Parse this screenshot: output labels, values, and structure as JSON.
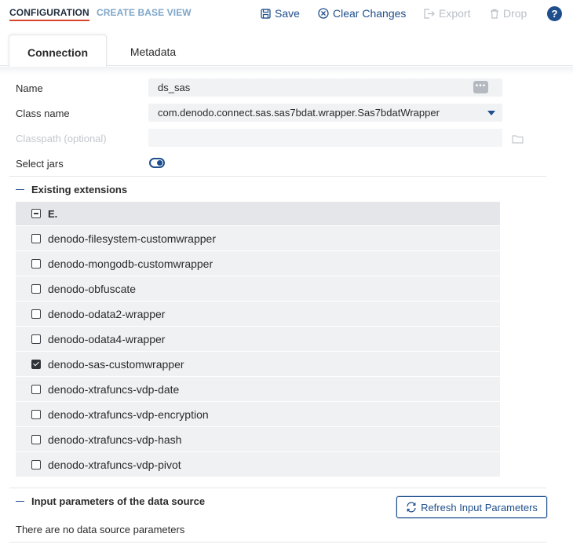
{
  "header": {
    "tabs": [
      {
        "label": "CONFIGURATION",
        "active": true
      },
      {
        "label": "CREATE BASE VIEW",
        "active": false
      }
    ],
    "actions": [
      {
        "label": "Save",
        "icon": "save-icon",
        "enabled": true
      },
      {
        "label": "Clear Changes",
        "icon": "clear-icon",
        "enabled": true
      },
      {
        "label": "Export",
        "icon": "export-icon",
        "enabled": false
      },
      {
        "label": "Drop",
        "icon": "trash-icon",
        "enabled": false
      }
    ],
    "help_label": "?"
  },
  "subtabs": [
    {
      "label": "Connection",
      "active": true
    },
    {
      "label": "Metadata",
      "active": false
    }
  ],
  "form": {
    "name_label": "Name",
    "name_value": "ds_sas",
    "name_more": "•••",
    "class_label": "Class name",
    "class_value": "com.denodo.connect.sas.sas7bdat.wrapper.Sas7bdatWrapper",
    "classpath_label": "Classpath (optional)",
    "classpath_value": "",
    "select_jars_label": "Select jars",
    "select_jars_on": true
  },
  "extensions": {
    "title": "Existing extensions",
    "group_label": "E.",
    "items": [
      {
        "label": "denodo-filesystem-customwrapper",
        "checked": false
      },
      {
        "label": "denodo-mongodb-customwrapper",
        "checked": false
      },
      {
        "label": "denodo-obfuscate",
        "checked": false
      },
      {
        "label": "denodo-odata2-wrapper",
        "checked": false
      },
      {
        "label": "denodo-odata4-wrapper",
        "checked": false
      },
      {
        "label": "denodo-sas-customwrapper",
        "checked": true
      },
      {
        "label": "denodo-xtrafuncs-vdp-date",
        "checked": false
      },
      {
        "label": "denodo-xtrafuncs-vdp-encryption",
        "checked": false
      },
      {
        "label": "denodo-xtrafuncs-vdp-hash",
        "checked": false
      },
      {
        "label": "denodo-xtrafuncs-vdp-pivot",
        "checked": false
      }
    ]
  },
  "input_params": {
    "title": "Input parameters of the data source",
    "refresh_label": "Refresh Input Parameters",
    "empty_text": "There are no data source parameters"
  },
  "colors": {
    "accent": "#1f4e8c",
    "underline": "#d9432b",
    "disabled": "#b9bfc6"
  }
}
